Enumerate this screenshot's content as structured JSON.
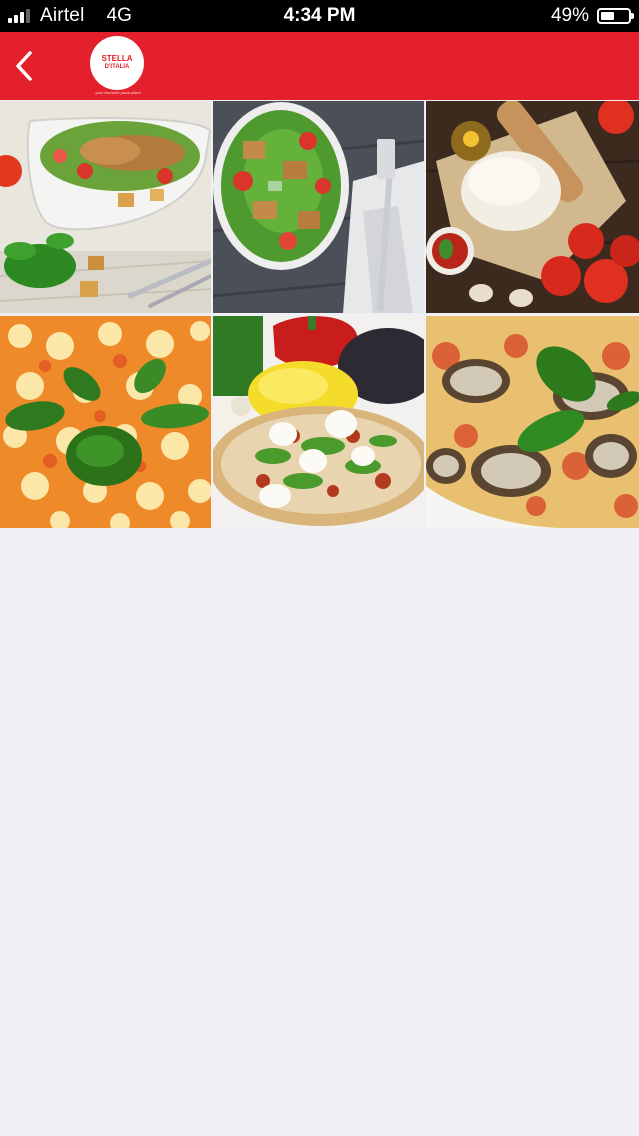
{
  "status_bar": {
    "carrier": "Airtel",
    "network": "4G",
    "time": "4:34 PM",
    "battery_percent": "49%",
    "battery_level": 0.49,
    "signal_bars_filled": 3,
    "signal_bars_total": 4
  },
  "nav": {
    "back_icon": "chevron-left-icon",
    "logo_line1": "STELLA",
    "logo_line2": "D'ITALIA",
    "logo_tagline": "your favourite pizza place",
    "bar_color": "#e3202c"
  },
  "gallery": {
    "tiles": [
      {
        "subject": "chicken-salad-bowl"
      },
      {
        "subject": "chicken-salad-with-fork"
      },
      {
        "subject": "pizza-dough-and-tomatoes"
      },
      {
        "subject": "margherita-pizza"
      },
      {
        "subject": "vegetable-pizza"
      },
      {
        "subject": "eggplant-pizza"
      }
    ]
  }
}
